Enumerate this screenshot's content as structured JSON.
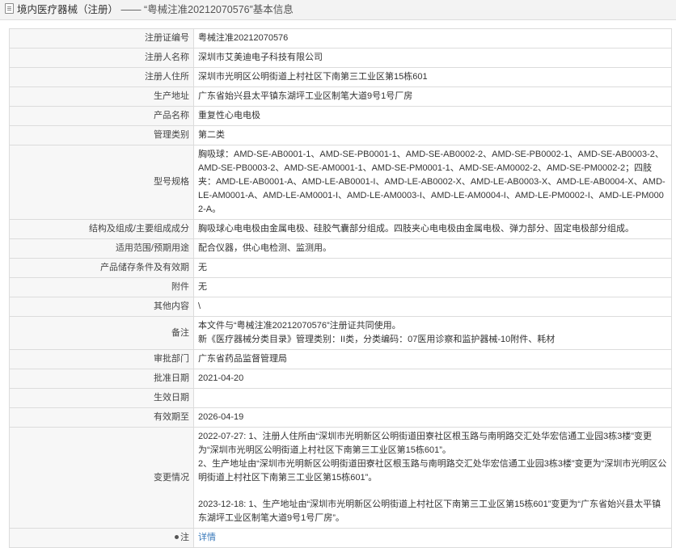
{
  "header": {
    "icon": "document-icon",
    "link_text": "境内医疗器械（注册）",
    "separator": "——",
    "title": "“粤械注准20212070576”基本信息"
  },
  "rows": [
    {
      "label": "注册证编号",
      "value": "粤械注准20212070576"
    },
    {
      "label": "注册人名称",
      "value": "深圳市艾美迪电子科技有限公司"
    },
    {
      "label": "注册人住所",
      "value": "深圳市光明区公明街道上村社区下南第三工业区第15栋601"
    },
    {
      "label": "生产地址",
      "value": "广东省始兴县太平镇东湖坪工业区制笔大道9号1号厂房"
    },
    {
      "label": "产品名称",
      "value": "重复性心电电极"
    },
    {
      "label": "管理类别",
      "value": "第二类"
    },
    {
      "label": "型号规格",
      "value": "胸吸球：AMD-SE-AB0001-1、AMD-SE-PB0001-1、AMD-SE-AB0002-2、AMD-SE-PB0002-1、AMD-SE-AB0003-2、AMD-SE-PB0003-2、AMD-SE-AM0001-1、AMD-SE-PM0001-1、AMD-SE-AM0002-2、AMD-SE-PM0002-2；四肢夹：AMD-LE-AB0001-A、AMD-LE-AB0001-I、AMD-LE-AB0002-X、AMD-LE-AB0003-X、AMD-LE-AB0004-X、AMD-LE-AM0001-A、AMD-LE-AM0001-I、AMD-LE-AM0003-I、AMD-LE-AM0004-I、AMD-LE-PM0002-I、AMD-LE-PM0002-A。"
    },
    {
      "label": "结构及组成/主要组成成分",
      "value": "胸吸球心电电极由金属电极、硅胶气囊部分组成。四肢夹心电电极由金属电极、弹力部分、固定电极部分组成。"
    },
    {
      "label": "适用范围/预期用途",
      "value": "配合仪器，供心电检测、监测用。"
    },
    {
      "label": "产品储存条件及有效期",
      "value": "无"
    },
    {
      "label": "附件",
      "value": "无"
    },
    {
      "label": "其他内容",
      "value": "\\"
    },
    {
      "label": "备注",
      "value_lines": [
        "本文件与“粤械注准20212070576”注册证共同使用。",
        "新《医疗器械分类目录》管理类别：II类，分类编码：07医用诊察和监护器械-10附件、耗材"
      ]
    },
    {
      "label": "审批部门",
      "value": "广东省药品监督管理局"
    },
    {
      "label": "批准日期",
      "value": "2021-04-20"
    },
    {
      "label": "生效日期",
      "value": ""
    },
    {
      "label": "有效期至",
      "value": "2026-04-19"
    },
    {
      "label": "变更情况",
      "change_1": "2022-07-27: 1、注册人住所由“深圳市光明新区公明街道田寮社区根玉路与南明路交汇处华宏信通工业园3栋3楼”变更为“深圳市光明区公明街道上村社区下南第三工业区第15栋601”。\n2、生产地址由“深圳市光明新区公明街道田寮社区根玉路与南明路交汇处华宏信通工业园3栋3楼”变更为“深圳市光明区公明街道上村社区下南第三工业区第15栋601”。",
      "change_2": "2023-12-18: 1、生产地址由“深圳市光明新区公明街道上村社区下南第三工业区第15栋601”变更为“广东省始兴县太平镇东湖坪工业区制笔大道9号1号厂房”。"
    },
    {
      "label": "注",
      "label_icon": "footnote-icon",
      "link": "详情"
    }
  ]
}
